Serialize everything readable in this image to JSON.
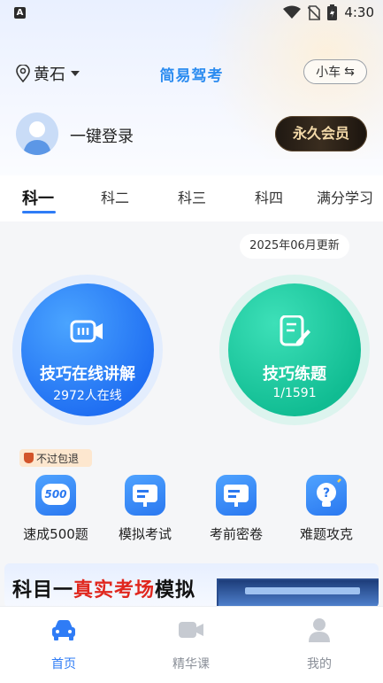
{
  "status_bar": {
    "time": "4:30",
    "app_icon": "A"
  },
  "header": {
    "location": "黄石",
    "title": "简易驾考",
    "car_type": "小车",
    "switch_glyph": "⇆"
  },
  "user": {
    "login_text": "一键登录",
    "vip_label": "永久会员"
  },
  "tabs": [
    {
      "label": "科一",
      "active": true
    },
    {
      "label": "科二"
    },
    {
      "label": "科三"
    },
    {
      "label": "科四"
    },
    {
      "label": "满分学习"
    }
  ],
  "update_badge": "2025年06月更新",
  "cards": {
    "lecture": {
      "title": "技巧在线讲解",
      "subtitle": "2972人在线",
      "icon": "video-icon"
    },
    "practice": {
      "title": "技巧练题",
      "subtitle": "1/1591",
      "icon": "notepad-icon"
    }
  },
  "guarantee_tag": "不过包退",
  "grid": [
    {
      "label": "速成500题",
      "icon": "badge-500-icon",
      "icon_text": "500"
    },
    {
      "label": "模拟考试",
      "icon": "monitor-icon"
    },
    {
      "label": "考前密卷",
      "icon": "monitor-icon"
    },
    {
      "label": "难题攻克",
      "icon": "lightbulb-icon"
    }
  ],
  "banner": {
    "prefix": "科目一",
    "highlight": "真实考场",
    "suffix": "模拟"
  },
  "bottom_nav": [
    {
      "label": "首页",
      "icon": "car-icon",
      "active": true
    },
    {
      "label": "精华课",
      "icon": "video-icon"
    },
    {
      "label": "我的",
      "icon": "person-icon"
    }
  ],
  "colors": {
    "primary": "#2f7cf6",
    "green": "#10bc92",
    "vip_gold": "#f3d9a8",
    "banner_red": "#e0271e"
  }
}
